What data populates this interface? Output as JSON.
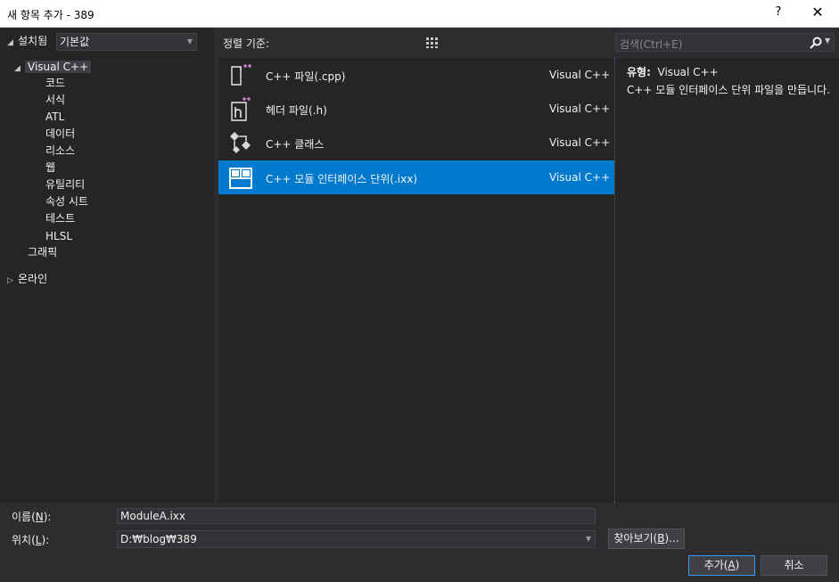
{
  "window": {
    "title": "새 항목 추가 - 389",
    "help_label": "?",
    "close_label": "✕"
  },
  "tree": {
    "installed": "설치됨",
    "visual_cpp": "Visual C++",
    "children": [
      "코드",
      "서식",
      "ATL",
      "데이터",
      "리소스",
      "웹",
      "유틸리티",
      "속성 시트",
      "테스트",
      "HLSL"
    ],
    "graphics": "그래픽",
    "online": "온라인"
  },
  "toolbar": {
    "sort_label": "정렬 기준:",
    "sort_value": "기본값"
  },
  "search": {
    "placeholder": "검색(Ctrl+E)"
  },
  "templates": [
    {
      "name": "C++ 파일(.cpp)",
      "type": "Visual C++",
      "icon": "cpp-file-icon"
    },
    {
      "name": "헤더 파일(.h)",
      "type": "Visual C++",
      "icon": "header-file-icon"
    },
    {
      "name": "C++ 클래스",
      "type": "Visual C++",
      "icon": "cpp-class-icon"
    },
    {
      "name": "C++ 모듈 인터페이스 단위(.ixx)",
      "type": "Visual C++",
      "icon": "module-interface-icon",
      "selected": true
    }
  ],
  "info": {
    "type_label": "유형:",
    "type_value": "Visual C++",
    "description": "C++ 모듈 인터페이스 단위 파일을 만듭니다."
  },
  "form": {
    "name_label": "이름(",
    "name_key": "N",
    "name_value": "ModuleA.ixx",
    "location_label": "위치(",
    "location_key": "L",
    "location_value": "D:₩blog₩389",
    "label_suffix": "):",
    "browse_prefix": "찾아보기(",
    "browse_key": "B",
    "browse_suffix": ")...",
    "add_prefix": "추가(",
    "add_key": "A",
    "add_suffix": ")",
    "cancel": "취소"
  },
  "colors": {
    "selection": "#007acc",
    "background": "#2d2d30",
    "panel": "#252526",
    "accent_icon": "#d17fd6"
  }
}
